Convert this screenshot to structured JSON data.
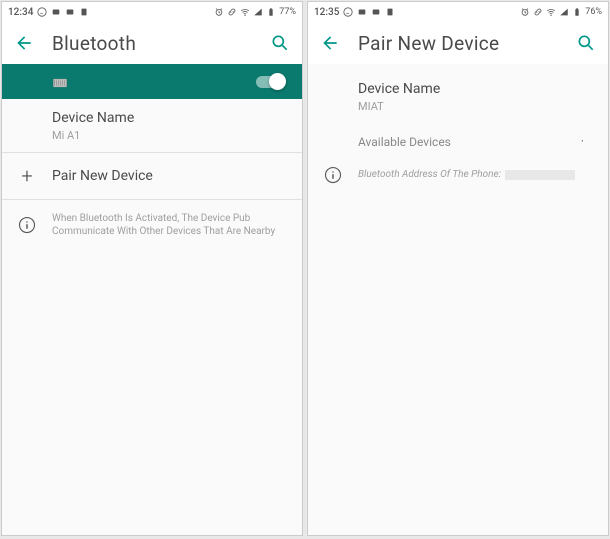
{
  "left": {
    "status": {
      "time": "12:34",
      "battery": "77%"
    },
    "title": "Bluetooth",
    "device_name_label": "Device Name",
    "device_name_value": "Mi A1",
    "pair_label": "Pair New Device",
    "info_text": "When Bluetooth Is Activated, The Device Pub Communicate With Other Devices That Are Nearby"
  },
  "right": {
    "status": {
      "time": "12:35",
      "battery": "76%"
    },
    "title": "Pair New Device",
    "device_name_label": "Device Name",
    "device_name_value": "MIAT",
    "available_label": "Available Devices",
    "address_label": "Bluetooth Address Of The Phone:"
  }
}
